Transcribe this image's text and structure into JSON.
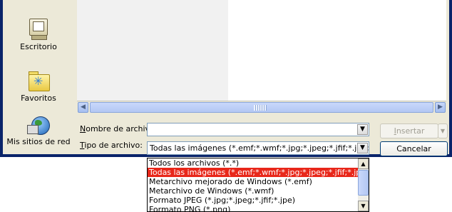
{
  "places": [
    {
      "label": "Escritorio",
      "icon": "desktop-icon"
    },
    {
      "label": "Favoritos",
      "icon": "favorites-folder-icon"
    },
    {
      "label": "Mis sitios de red",
      "icon": "network-places-icon"
    }
  ],
  "filename": {
    "label_key": "N",
    "label_rest": "ombre de archivo:",
    "value": ""
  },
  "filetype": {
    "label_key": "T",
    "label_rest": "ipo de archivo:",
    "value": "Todas las imágenes (*.emf;*.wmf;*.jpg;*.jpeg;*.jfif;*.jpe;"
  },
  "buttons": {
    "insert_key": "I",
    "insert_rest": "nsertar",
    "cancel": "Cancelar"
  },
  "dropdown_items": [
    "Todos los archivos (*.*)",
    "Todas las imágenes (*.emf;*.wmf;*.jpg;*.jpeg;*.jfif;*.jpe;",
    "Metarchivo mejorado de Windows (*.emf)",
    "Metarchivo de Windows (*.wmf)",
    "Formato JPEG (*.jpg;*.jpeg;*.jfif;*.jpe)",
    "Formato PNG (*.png)"
  ],
  "selected_dropdown_index": 1,
  "colors": {
    "dialog_bg": "#ece9d8",
    "frame": "#0a246a",
    "selection": "#e8271a"
  }
}
